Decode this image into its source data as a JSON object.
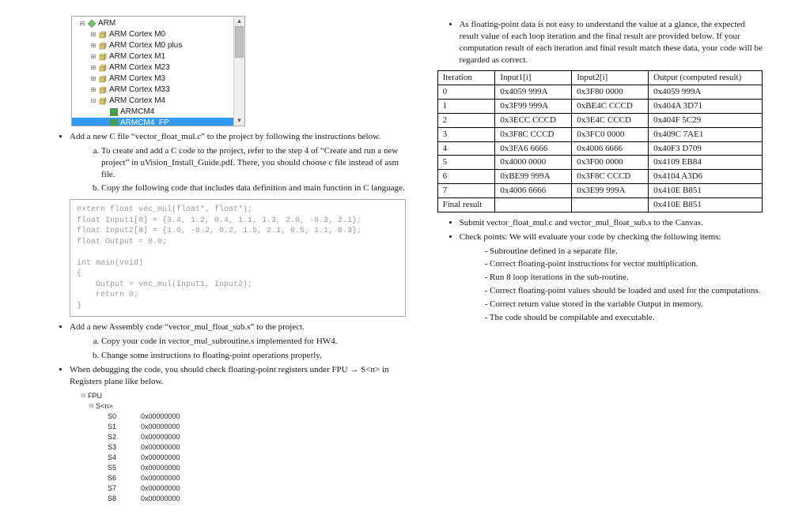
{
  "tree": {
    "items": [
      {
        "indent": 0,
        "exp": "⊟",
        "ico": "diamond",
        "label": "ARM"
      },
      {
        "indent": 1,
        "exp": "⊞",
        "ico": "cube",
        "label": "ARM Cortex M0"
      },
      {
        "indent": 1,
        "exp": "⊞",
        "ico": "cube",
        "label": "ARM Cortex M0 plus"
      },
      {
        "indent": 1,
        "exp": "⊞",
        "ico": "cube",
        "label": "ARM Cortex M1"
      },
      {
        "indent": 1,
        "exp": "⊞",
        "ico": "cube",
        "label": "ARM Cortex M23"
      },
      {
        "indent": 1,
        "exp": "⊞",
        "ico": "cube",
        "label": "ARM Cortex M3"
      },
      {
        "indent": 1,
        "exp": "⊞",
        "ico": "cube",
        "label": "ARM Cortex M33"
      },
      {
        "indent": 1,
        "exp": "⊟",
        "ico": "cube",
        "label": "ARM Cortex M4"
      },
      {
        "indent": 2,
        "exp": "",
        "ico": "pkg",
        "label": "ARMCM4"
      },
      {
        "indent": 2,
        "exp": "",
        "ico": "pkg",
        "label": "ARMCM4_FP",
        "sel": true
      }
    ]
  },
  "bullet1": "Add a new C file “vector_float_mul.c” to the project by following the instructions below.",
  "bullet1a": "To create and add a C code to the project, refer to the step 4 of “Create and run a new project” in uVision_Install_Guide.pdf. There, you should choose c file instead of asm file.",
  "bullet1b": "Copy the following code that includes data definition and main function in C language.",
  "code1": "extern float vec_mul(float*, float*);\nfloat Input1[8] = {3.4, 1.2, 0.4, 1.1, 1.3, 2.0, -0.3, 2.1};\nfloat Input2[8] = {1.0, -0.2, 0.2, 1.5, 2.1, 0.5, 1.1, 0.3};\nfloat Output = 0.0;\n\nint main(void)\n{\n    Output = vec_mul(Input1, Input2);\n    return 0;\n}",
  "bullet2": "Add a new Assembly code “vector_mul_float_sub.s” to the project.",
  "bullet2a": "Copy your code in vector_mul_subroutine.s implemented for HW4.",
  "bullet2b": "Change some instructions to floating-point operations properly.",
  "bullet3": "When debugging the code, you should check floating-point registers under FPU → S<n> in Registers plane like below.",
  "fpu": {
    "root": "FPU",
    "group": "S<n>",
    "regs": [
      {
        "n": "S0",
        "v": "0x00000000"
      },
      {
        "n": "S1",
        "v": "0x00000000"
      },
      {
        "n": "S2",
        "v": "0x00000000"
      },
      {
        "n": "S3",
        "v": "0x00000000"
      },
      {
        "n": "S4",
        "v": "0x00000000"
      },
      {
        "n": "S5",
        "v": "0x00000000"
      },
      {
        "n": "S6",
        "v": "0x00000000"
      },
      {
        "n": "S7",
        "v": "0x00000000"
      },
      {
        "n": "S8",
        "v": "0x00000000"
      }
    ]
  },
  "right_intro": "As floating-point data is not easy to understand the value at a glance, the expected result value of each loop iteration and the final result are provided below. If your computation result of each iteration and final result match these data, your code will be regarded as correct.",
  "table": {
    "headers": [
      "Iteration",
      "Input1[i]",
      "Input2[i]",
      "Output (computed result)"
    ],
    "rows": [
      [
        "0",
        "0x4059 999A",
        "0x3F80 0000",
        "0x4059 999A"
      ],
      [
        "1",
        "0x3F99 999A",
        "0xBE4C CCCD",
        "0x404A 3D71"
      ],
      [
        "2",
        "0x3ECC CCCD",
        "0x3E4C CCCD",
        "0x404F 5C29"
      ],
      [
        "3",
        "0x3F8C CCCD",
        "0x3FC0 0000",
        "0x409C 7AE1"
      ],
      [
        "4",
        "0x3FA6 6666",
        "0x4006 6666",
        "0x40F3 D709"
      ],
      [
        "5",
        "0x4000 0000",
        "0x3F00 0000",
        "0x4109 EB84"
      ],
      [
        "6",
        "0xBE99 999A",
        "0x3F8C CCCD",
        "0x4104 A3D6"
      ],
      [
        "7",
        "0x4006 6666",
        "0x3E99 999A",
        "0x410E B851"
      ],
      [
        "Final result",
        "",
        "",
        "0x410E B851"
      ]
    ]
  },
  "submit": "Submit vector_float_mul.c and vector_mul_float_sub.s to the Canvas.",
  "check_intro": "Check points: We will evaluate your code by checking the following items:",
  "checks": [
    "Subroutine defined in a separate file.",
    "Correct floating-point instructions for vector multiplication.",
    "Run 8 loop iterations in the sub-routine.",
    "Correct floating-point values should be loaded and used for the computations.",
    "Correct return value stored in the variable Output in memory.",
    "The code should be compilable and executable."
  ]
}
